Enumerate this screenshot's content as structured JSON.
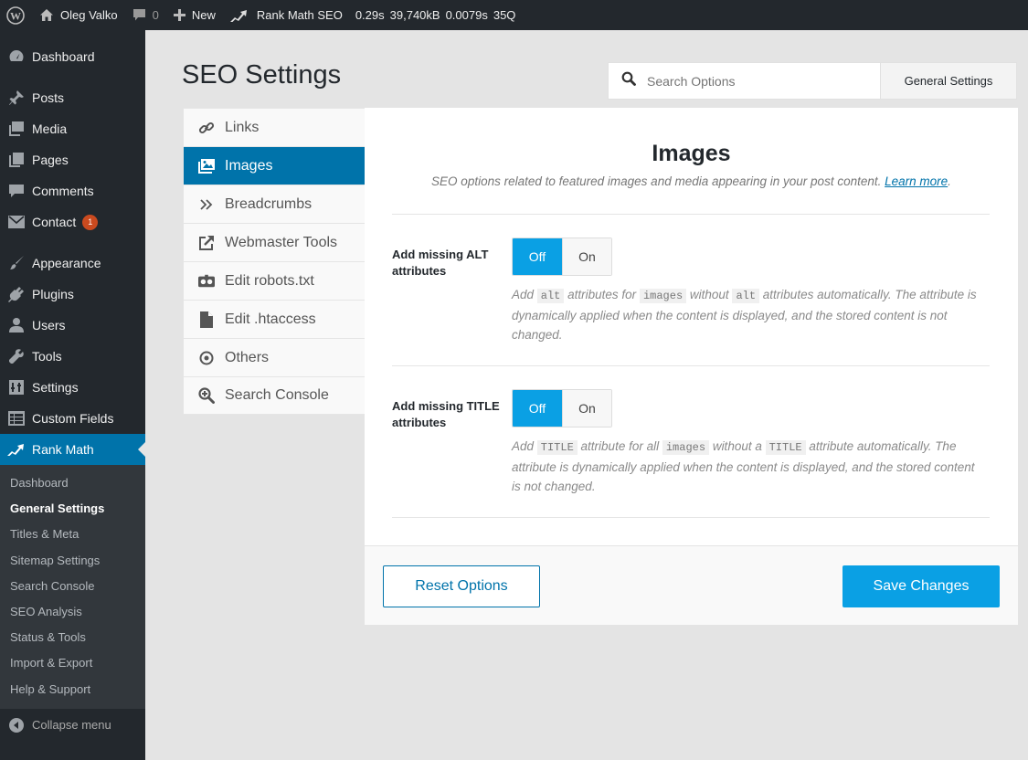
{
  "admin_bar": {
    "site_name": "Oleg Valko",
    "comments_count": "0",
    "new_label": "New",
    "plugin_label": "Rank Math SEO",
    "stats": [
      "0.29s",
      "39,740kB",
      "0.0079s",
      "35Q"
    ]
  },
  "sidebar": {
    "items": [
      {
        "label": "Dashboard",
        "icon": "dashboard-icon"
      },
      {
        "label": "Posts",
        "icon": "pin-icon"
      },
      {
        "label": "Media",
        "icon": "media-icon"
      },
      {
        "label": "Pages",
        "icon": "pages-icon"
      },
      {
        "label": "Comments",
        "icon": "comment-icon"
      },
      {
        "label": "Contact",
        "icon": "mail-icon",
        "badge": "1"
      },
      {
        "label": "Appearance",
        "icon": "brush-icon"
      },
      {
        "label": "Plugins",
        "icon": "plugin-icon"
      },
      {
        "label": "Users",
        "icon": "user-icon"
      },
      {
        "label": "Tools",
        "icon": "wrench-icon"
      },
      {
        "label": "Settings",
        "icon": "settings-icon"
      },
      {
        "label": "Custom Fields",
        "icon": "table-icon"
      },
      {
        "label": "Rank Math",
        "icon": "rank-math-icon"
      }
    ],
    "submenu": [
      "Dashboard",
      "General Settings",
      "Titles & Meta",
      "Sitemap Settings",
      "Search Console",
      "SEO Analysis",
      "Status & Tools",
      "Import & Export",
      "Help & Support"
    ],
    "collapse_label": "Collapse menu"
  },
  "page": {
    "title": "SEO Settings",
    "search_placeholder": "Search Options",
    "settings_scope": "General Settings"
  },
  "tabs": [
    {
      "label": "Links",
      "icon": "link-icon"
    },
    {
      "label": "Images",
      "icon": "image-icon"
    },
    {
      "label": "Breadcrumbs",
      "icon": "double-chevron-icon"
    },
    {
      "label": "Webmaster Tools",
      "icon": "external-link-icon"
    },
    {
      "label": "Edit robots.txt",
      "icon": "robot-icon"
    },
    {
      "label": "Edit .htaccess",
      "icon": "file-icon"
    },
    {
      "label": "Others",
      "icon": "target-icon"
    },
    {
      "label": "Search Console",
      "icon": "zoom-icon"
    }
  ],
  "panel": {
    "title": "Images",
    "description": "SEO options related to featured images and media appearing in your post content.",
    "learn_more": "Learn more",
    "fields": [
      {
        "label": "Add missing ALT attributes",
        "off_label": "Off",
        "on_label": "On",
        "desc_parts": [
          "Add ",
          "alt",
          " attributes for ",
          "images",
          " without ",
          "alt",
          " attributes automatically. The attribute is dynamically applied when the content is displayed, and the stored content is not changed."
        ]
      },
      {
        "label": "Add missing TITLE attributes",
        "off_label": "Off",
        "on_label": "On",
        "desc_parts": [
          "Add ",
          "TITLE",
          " attribute for all ",
          "images",
          " without a ",
          "TITLE",
          " attribute automatically. The attribute is dynamically applied when the content is displayed, and the stored content is not changed."
        ]
      }
    ],
    "reset_label": "Reset Options",
    "save_label": "Save Changes"
  },
  "colors": {
    "accent": "#0073aa",
    "button_blue": "#0aa0e4",
    "badge": "#ca4a1f",
    "sidebar_bg": "#23282d"
  }
}
